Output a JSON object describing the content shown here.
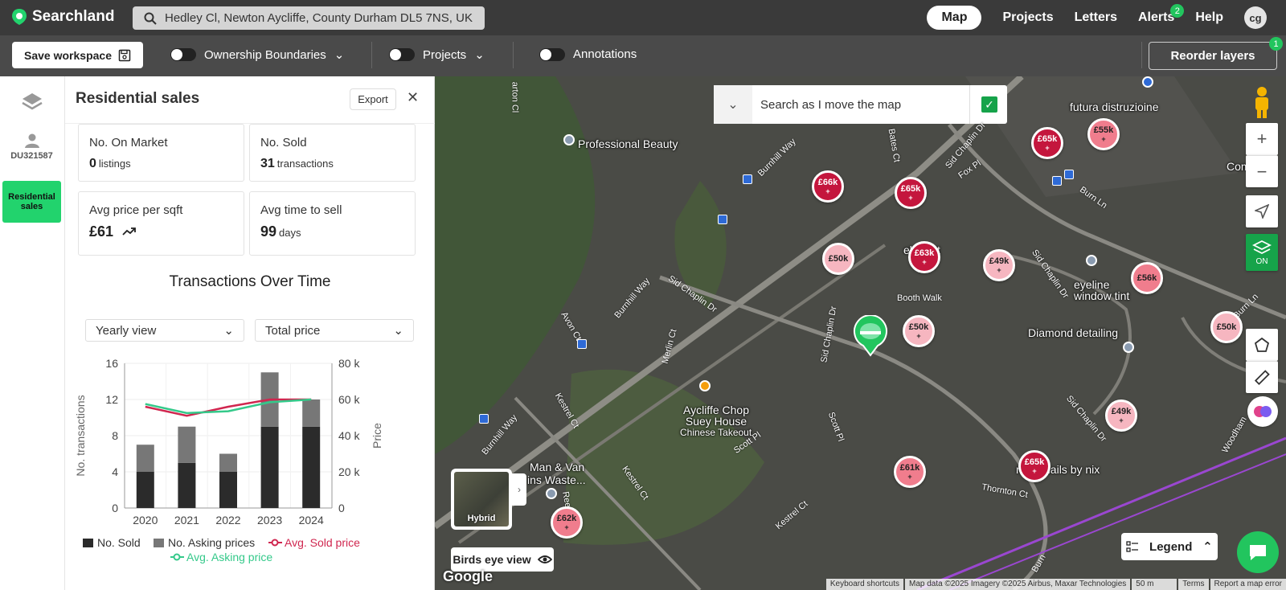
{
  "app": {
    "name": "Searchland"
  },
  "search": {
    "value": "Hedley Cl, Newton Aycliffe, County Durham DL5 7NS, UK"
  },
  "nav": {
    "map": "Map",
    "projects": "Projects",
    "letters": "Letters",
    "alerts": "Alerts",
    "alerts_count": "2",
    "help": "Help",
    "avatar": "cg"
  },
  "toolbar": {
    "save_workspace": "Save workspace",
    "ownership": "Ownership Boundaries",
    "projects": "Projects",
    "annotations": "Annotations",
    "reorder": "Reorder layers",
    "reorder_count": "1"
  },
  "rail": {
    "title_id": "DU321587",
    "active": "Residential sales"
  },
  "panel": {
    "title": "Residential sales",
    "export": "Export",
    "stats": [
      {
        "label": "No. On Market",
        "value": "0",
        "unit": "listings"
      },
      {
        "label": "No. Sold",
        "value": "31",
        "unit": "transactions"
      },
      {
        "label": "Avg price per sqft",
        "value": "£61",
        "unit": ""
      },
      {
        "label": "Avg time to sell",
        "value": "99",
        "unit": "days"
      }
    ],
    "chart_title": "Transactions Over Time",
    "view_select": "Yearly view",
    "metric_select": "Total price"
  },
  "chart_data": {
    "type": "bar",
    "categories": [
      "2020",
      "2021",
      "2022",
      "2023",
      "2024"
    ],
    "series": [
      {
        "name": "No. Sold",
        "type": "bar",
        "color": "#2b2b2b",
        "values": [
          4,
          5,
          4,
          9,
          9
        ]
      },
      {
        "name": "No. Asking prices",
        "type": "bar",
        "color": "#777777",
        "values": [
          3,
          4,
          2,
          6,
          3
        ]
      },
      {
        "name": "Avg. Sold price",
        "type": "line",
        "color": "#d0264f",
        "values": [
          56000,
          51000,
          56000,
          60000,
          60000
        ]
      },
      {
        "name": "Avg. Asking price",
        "type": "line",
        "color": "#34c98a",
        "values": [
          57500,
          52500,
          53500,
          58500,
          60000
        ]
      }
    ],
    "ylabel": "No. transactions",
    "y2label": "Price",
    "ylim": [
      0,
      16
    ],
    "y2lim": [
      0,
      80000
    ],
    "yticks": [
      "0",
      "4",
      "8",
      "12",
      "16"
    ],
    "y2ticks": [
      "0",
      "20 k",
      "40 k",
      "60 k",
      "80 k"
    ],
    "stack": true,
    "legend": "bottom"
  },
  "map": {
    "search_label": "Search as I move the map",
    "places": [
      {
        "name": "Professional Beauty"
      },
      {
        "name": "futura distruzioine"
      },
      {
        "name": "eyeline window tint"
      },
      {
        "name": "Diamond detailing"
      },
      {
        "name": "Aycliffe Chop Suey House"
      },
      {
        "name": "Chinese Takeout"
      },
      {
        "name": "Man & Van"
      },
      {
        "name": "ins Waste..."
      },
      {
        "name": "nds - nails by nix"
      },
      {
        "name": "el Blast"
      },
      {
        "name": "Compute"
      }
    ],
    "roads": [
      "Burnhill Way",
      "Sid Chaplin Dr",
      "Avon Ct",
      "Merlin Ct",
      "Booth Walk",
      "Bates Ct",
      "Fox Pl",
      "Burn Ln",
      "Kestrel Ct",
      "Scott Pl",
      "Thornton Ct",
      "arton Cl",
      "Woodham",
      "Reeth",
      "Burn"
    ],
    "prices": [
      "£65k",
      "£55k",
      "£66k",
      "£65k",
      "£50k",
      "£63k",
      "£49k",
      "£56k",
      "£50k",
      "£50k",
      "£49k",
      "£61k",
      "£65k",
      "£62k"
    ],
    "hybrid": "Hybrid",
    "birds_eye": "Birds eye view",
    "layers_on": "ON",
    "legend": "Legend",
    "google": "Google",
    "attribution": [
      "Keyboard shortcuts",
      "Map data ©2025 Imagery ©2025 Airbus, Maxar Technologies",
      "50 m",
      "Terms",
      "Report a map error"
    ]
  }
}
